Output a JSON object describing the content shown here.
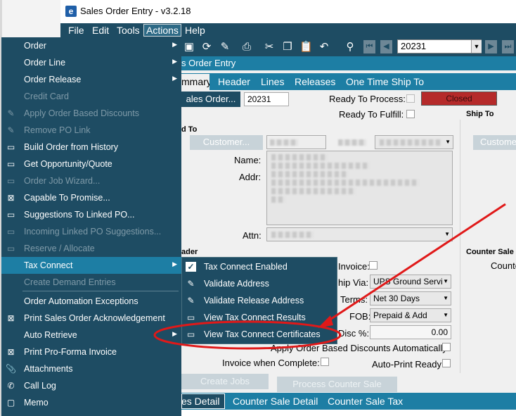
{
  "window": {
    "title": "Sales Order Entry - v3.2.18",
    "icon_letter": "e"
  },
  "menubar": {
    "items": [
      "File",
      "Edit",
      "Tools",
      "Actions",
      "Help"
    ]
  },
  "toolbar": {
    "order_number": "20231"
  },
  "subtitle": "s Order Entry",
  "tabs": [
    "mmary",
    "Header",
    "Lines",
    "Releases",
    "One Time Ship To"
  ],
  "form": {
    "sales_order_button": "ales Order...",
    "sales_order_value": "20231",
    "ready_to_process_label": "Ready To Process:",
    "status": "Closed",
    "status_color": "#b52a2a",
    "ready_to_fulfill_label": "Ready To Fulfill:",
    "ship_to_header": "Ship To",
    "sold_to_header": "d To",
    "customer_button": "Customer...",
    "customer_button_right": "Custome",
    "name_label": "Name:",
    "addr_label": "Addr:",
    "attn_label": "Attn:",
    "header_section": "ader",
    "counter_sale_header": "Counter Sale",
    "counter_label": "Counte",
    "invoice_label": "Invoice:",
    "ship_via_label": "hip Via:",
    "ship_via_value": "UPS Ground Servi",
    "terms_label": "Terms:",
    "terms_value": "Net 30 Days",
    "fob_label": "FOB:",
    "fob_value": "Prepaid & Add",
    "disc_label": "Disc %:",
    "disc_value": "0.00",
    "apply_discounts_label": "Apply Order Based Discounts Automatically:",
    "invoice_when_complete_label": "Invoice when Complete:",
    "auto_print_label": "Auto-Print Ready:",
    "create_jobs_button": "Create Jobs",
    "process_counter_sale_button": "Process Counter Sale"
  },
  "bottom_tabs": [
    "es Detail",
    "Counter Sale Detail",
    "Counter Sale Tax"
  ],
  "actions_menu": {
    "items": [
      {
        "label": "Order",
        "icon": "",
        "submenu": true,
        "enabled": true
      },
      {
        "label": "Order Line",
        "icon": "",
        "submenu": true,
        "enabled": true
      },
      {
        "label": "Order Release",
        "icon": "",
        "submenu": true,
        "enabled": true
      },
      {
        "label": "Credit Card",
        "icon": "",
        "submenu": false,
        "enabled": false
      },
      {
        "label": "Apply Order Based Discounts",
        "icon": "edit-icon",
        "submenu": false,
        "enabled": false
      },
      {
        "label": "Remove PO Link",
        "icon": "edit-icon",
        "submenu": false,
        "enabled": false
      },
      {
        "label": "Build Order from History",
        "icon": "window-icon",
        "submenu": false,
        "enabled": true
      },
      {
        "label": "Get Opportunity/Quote",
        "icon": "window-icon",
        "submenu": false,
        "enabled": true
      },
      {
        "label": "Order Job Wizard...",
        "icon": "window-icon",
        "submenu": false,
        "enabled": false
      },
      {
        "label": "Capable To Promise...",
        "icon": "close-window-icon",
        "submenu": false,
        "enabled": true
      },
      {
        "label": "Suggestions To Linked PO...",
        "icon": "window-icon",
        "submenu": false,
        "enabled": true
      },
      {
        "label": "Incoming Linked PO Suggestions...",
        "icon": "window-icon",
        "submenu": false,
        "enabled": false
      },
      {
        "label": "Reserve / Allocate",
        "icon": "window-icon",
        "submenu": false,
        "enabled": false
      },
      {
        "label": "Tax Connect",
        "icon": "",
        "submenu": true,
        "enabled": true,
        "highlighted": true
      },
      {
        "label": "Create Demand Entries",
        "icon": "",
        "submenu": false,
        "enabled": false
      },
      {
        "label": "Order Automation Exceptions",
        "icon": "",
        "submenu": false,
        "enabled": true
      },
      {
        "label": "Print Sales Order Acknowledgement",
        "icon": "close-window-icon",
        "submenu": false,
        "enabled": true
      },
      {
        "label": "Auto Retrieve",
        "icon": "",
        "submenu": true,
        "enabled": true
      },
      {
        "label": "Print Pro-Forma Invoice",
        "icon": "close-window-icon",
        "submenu": false,
        "enabled": true
      },
      {
        "label": "Attachments",
        "icon": "attachment-icon",
        "submenu": false,
        "enabled": true
      },
      {
        "label": "Call Log",
        "icon": "phone-icon",
        "submenu": false,
        "enabled": true
      },
      {
        "label": "Memo",
        "icon": "memo-icon",
        "submenu": false,
        "enabled": true
      }
    ]
  },
  "tax_connect_submenu": {
    "items": [
      {
        "label": "Tax Connect Enabled",
        "icon": "check-icon"
      },
      {
        "label": "Validate Address",
        "icon": "edit-icon"
      },
      {
        "label": "Validate Release Address",
        "icon": "edit-icon"
      },
      {
        "label": "View Tax Connect Results",
        "icon": "window-icon"
      },
      {
        "label": "View Tax Connect Certificates",
        "icon": "window-icon"
      }
    ]
  },
  "annotation": {
    "color": "#e01919"
  }
}
